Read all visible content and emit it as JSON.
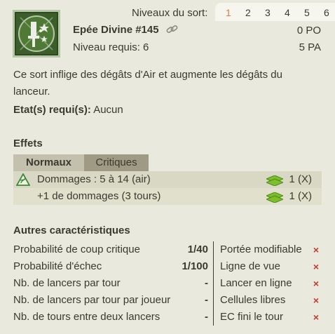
{
  "levels": {
    "label": "Niveaux du sort:",
    "options": [
      "1",
      "2",
      "3",
      "4",
      "5",
      "6"
    ],
    "active": "1"
  },
  "spell": {
    "icon": "sword-stars-spell-icon",
    "name": "Epée Divine #145",
    "link_icon": "link-icon",
    "cost_po": "0 PO",
    "level_required": "Niveau requis: 6",
    "cost_pa": "5 PA",
    "description": "Ce sort inflige des dégâts d'Air et augmente les dégâts du lanceur.",
    "states_label": "Etat(s) requi(s):",
    "states_value": "Aucun"
  },
  "effects": {
    "title": "Effets",
    "tabs": [
      "Normaux",
      "Critiques"
    ],
    "active_tab": "Normaux",
    "rows": [
      {
        "icon": "air-element-icon",
        "text": "Dommages : 5 à 14 (air)",
        "zone_icon": "zone-icon",
        "qty": "1 (X)"
      },
      {
        "icon": "",
        "text": "+1 de dommages (3 tours)",
        "zone_icon": "zone-icon",
        "qty": "1 (X)"
      }
    ]
  },
  "characteristics": {
    "title": "Autres caractéristiques",
    "rows": [
      {
        "label": "Probabilité de coup critique",
        "value": "1/40",
        "prop": "Portée modifiable"
      },
      {
        "label": "Probabilité d'échec",
        "value": "1/100",
        "prop": "Ligne de vue"
      },
      {
        "label": "Nb. de lancers par tour",
        "value": "-",
        "prop": "Lancer en ligne"
      },
      {
        "label": "Nb. de lancers par tour par joueur",
        "value": "-",
        "prop": "Cellules libres"
      },
      {
        "label": "Nb. de tours entre deux lancers",
        "value": "-",
        "prop": "EC fini le tour"
      }
    ],
    "prop_icon": "x-icon",
    "prop_mark": "×",
    "prop_color": "#c0392b"
  },
  "colors": {
    "background": "#eae9dd",
    "accent_active_level": "#e0793f",
    "tab_active": "#c3c1ae",
    "tab_inactive": "#9e9a84"
  }
}
